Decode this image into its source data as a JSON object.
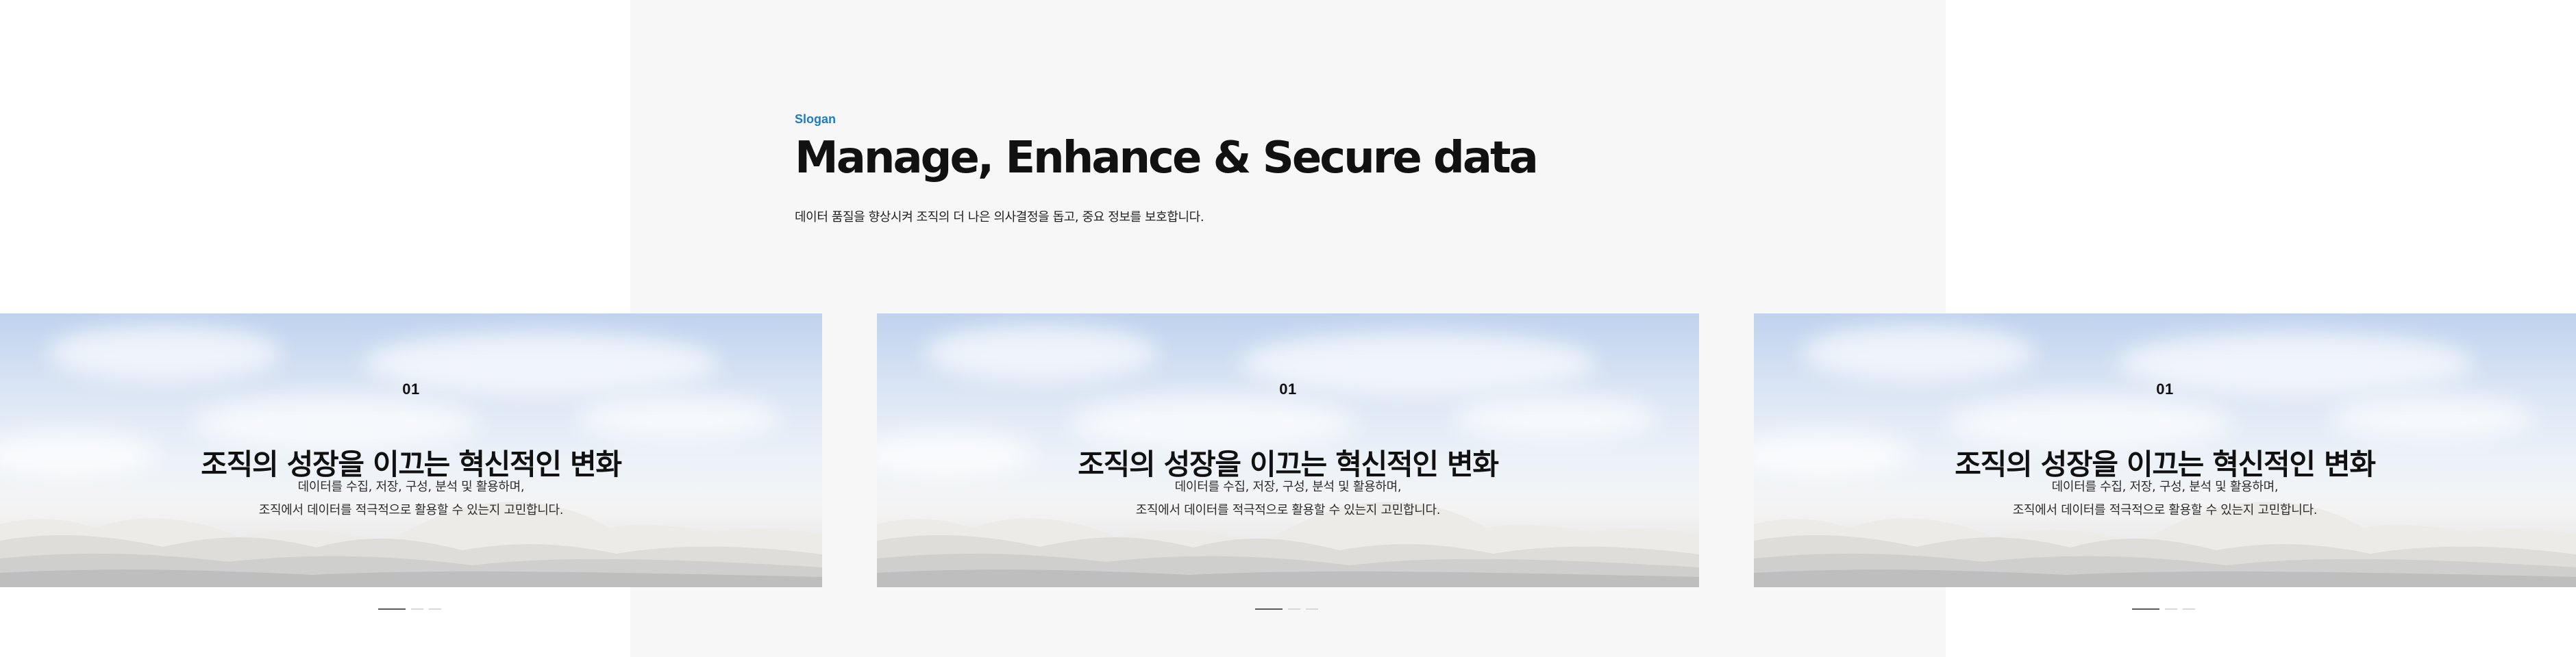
{
  "hero": {
    "eyebrow": "Slogan",
    "title": "Manage, Enhance & Secure data",
    "subtitle": "데이터 품질을 향상시켜 조직의 더 나은 의사결정을 돕고, 중요 정보를 보호합니다."
  },
  "slides": [
    {
      "number": "01",
      "title": "조직의 성장을 이끄는 혁신적인 변화",
      "description_line_1": "데이터를 수집, 저장, 구성, 분석 및 활용하며,",
      "description_line_2": "조직에서 데이터를 적극적으로 활용할 수 있는지 고민합니다."
    },
    {
      "number": "01",
      "title": "조직의 성장을 이끄는 혁신적인 변화",
      "description_line_1": "데이터를 수집, 저장, 구성, 분석 및 활용하며,",
      "description_line_2": "조직에서 데이터를 적극적으로 활용할 수 있는지 고민합니다."
    },
    {
      "number": "01",
      "title": "조직의 성장을 이끄는 혁신적인 변화",
      "description_line_1": "데이터를 수집, 저장, 구성, 분석 및 활용하며,",
      "description_line_2": "조직에서 데이터를 적극적으로 활용할 수 있는지 고민합니다."
    }
  ],
  "colors": {
    "accent": "#1e7bc6",
    "heading": "#111111",
    "panel_background": "#f7f7f7",
    "pagination_active": "#5a5a5a",
    "pagination_inactive": "#d9d9d9"
  }
}
